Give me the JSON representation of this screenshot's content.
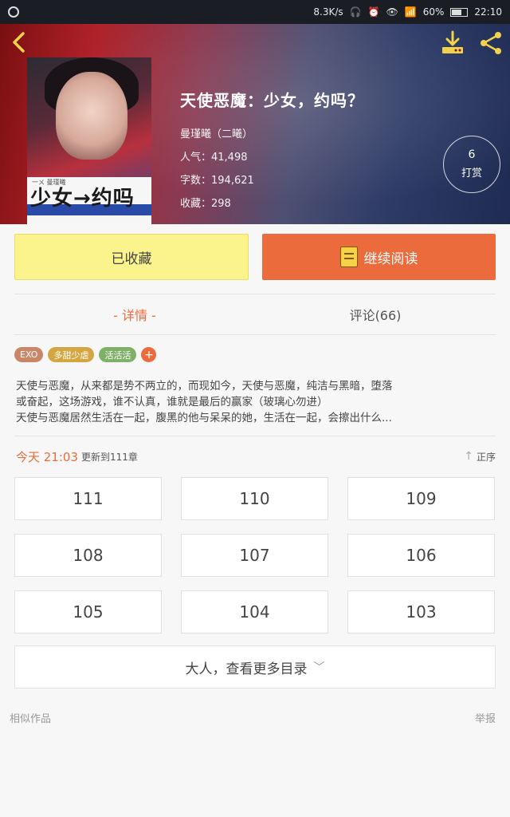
{
  "status_bar": {
    "speed": "8.3K/s",
    "battery": "60%",
    "time": "22:10"
  },
  "book": {
    "title": "天使恶魔：少女，约吗？",
    "author": "曼瑾曦（二曦）",
    "popularity": "人气：41,498",
    "word_count": "字数：194,621",
    "favorites": "收藏：298",
    "cover_title": "少女→约吗",
    "cover_author": "一ㄨ 曼瑾曦"
  },
  "tip": {
    "count": "6",
    "label": "打赏"
  },
  "actions": {
    "collect_label": "已收藏",
    "read_label": "继续阅读"
  },
  "tabs": [
    {
      "label": "- 详情 -",
      "active": true
    },
    {
      "label": "评论(66)",
      "active": false
    }
  ],
  "tags": [
    "EXO",
    "多甜少虐",
    "活活活"
  ],
  "tag_add": "+",
  "description": [
    "天使与恶魔，从来都是势不两立的，而现如今，天使与恶魔，纯洁与黑暗，堕落",
    "或奋起，这场游戏，谁不认真，谁就是最后的赢家（玻璃心勿进）",
    "天使与恶魔居然生活在一起，腹黑的他与呆呆的她，生活在一起，会擦出什么..."
  ],
  "update": {
    "time": "今天 21:03",
    "text": "更新到111章",
    "sort_label": "正序"
  },
  "chapters": [
    "111",
    "110",
    "109",
    "108",
    "107",
    "106",
    "105",
    "104",
    "103"
  ],
  "more_label": "大人，查看更多目录",
  "footer": {
    "similar_label": "相似作品",
    "report_label": "举报"
  },
  "colors": {
    "accent": "#ec6b3c",
    "collect_bg": "#fbf38c",
    "icon_yellow": "#f1d24a"
  }
}
